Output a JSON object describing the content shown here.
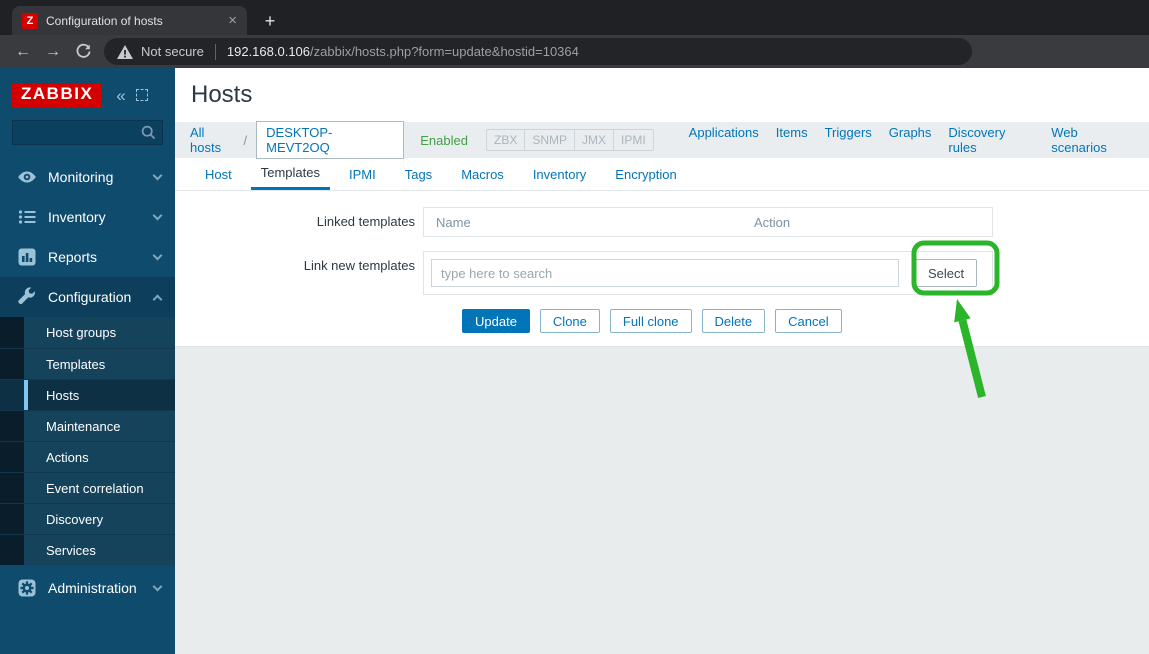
{
  "browser": {
    "tab": {
      "title": "Configuration of hosts",
      "close": "×",
      "favicon": "Z"
    },
    "new_tab": "+",
    "nav": {
      "back": "←",
      "forward": "→"
    },
    "omnibox": {
      "warning": "Not secure",
      "host": "192.168.0.106",
      "path": "/zabbix/hosts.php?form=update&hostid=10364"
    }
  },
  "sidebar": {
    "logo": "ZABBIX",
    "collapse": "«",
    "menu": [
      {
        "label": "Monitoring",
        "icon": "eye-icon"
      },
      {
        "label": "Inventory",
        "icon": "list-icon"
      },
      {
        "label": "Reports",
        "icon": "bar-chart-icon"
      },
      {
        "label": "Configuration",
        "icon": "wrench-icon"
      },
      {
        "label": "Administration",
        "icon": "gear-icon"
      }
    ],
    "submenu": [
      "Host groups",
      "Templates",
      "Hosts",
      "Maintenance",
      "Actions",
      "Event correlation",
      "Discovery",
      "Services"
    ],
    "active_item": "Hosts"
  },
  "main": {
    "title": "Hosts",
    "breadcrumb": {
      "root": "All hosts",
      "separator": "/",
      "host": "DESKTOP-MEVT2OQ",
      "status": "Enabled",
      "interfaces": [
        "ZBX",
        "SNMP",
        "JMX",
        "IPMI"
      ],
      "links": [
        "Applications",
        "Items",
        "Triggers",
        "Graphs",
        "Discovery rules",
        "Web scenarios"
      ]
    },
    "tabs": [
      "Host",
      "Templates",
      "IPMI",
      "Tags",
      "Macros",
      "Inventory",
      "Encryption"
    ],
    "active_tab": "Templates",
    "form": {
      "linked_label": "Linked templates",
      "col_name": "Name",
      "col_action": "Action",
      "link_new_label": "Link new templates",
      "search_placeholder": "type here to search",
      "select": "Select"
    },
    "footer_buttons": [
      "Update",
      "Clone",
      "Full clone",
      "Delete",
      "Cancel"
    ]
  },
  "colors": {
    "accent_blue": "#0275b8",
    "enabled_green": "#429e47",
    "highlight_green": "#2bb52b",
    "zabbix_red": "#d40000",
    "sidebar_bg": "#0e4b6c"
  }
}
